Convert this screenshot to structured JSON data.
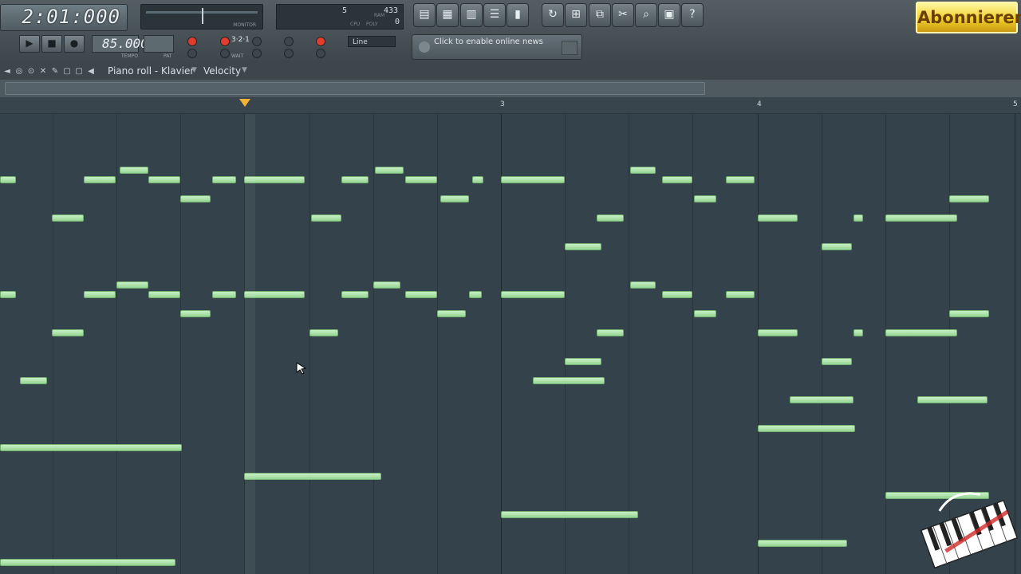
{
  "toolbar": {
    "song_position": "2:01:000",
    "meter_label": "MONITOR",
    "cpu": {
      "value_a": "5",
      "value_b": "433",
      "value_c": "0",
      "label_cpu": "CPU",
      "label_poly": "POLY",
      "label_ram": "RAM"
    },
    "tempo": "85.000",
    "tempo_label": "TEMPO",
    "pattern_label": "PAT",
    "snap_mode": "Line",
    "count_in": "3·2·1",
    "wait_label": "WAIT",
    "news_text": "Click to enable online news",
    "subscribe_label": "Abonnieren"
  },
  "piano_roll": {
    "title": "Piano roll - Klavier",
    "target": "Velocity",
    "bar_labels": [
      "3",
      "4",
      "5"
    ]
  },
  "note_color": "#a8dfa6",
  "icons": [
    "playlist-icon",
    "step-sequencer-icon",
    "piano-roll-icon",
    "browser-icon",
    "mixer-icon",
    "undo-icon",
    "save-icon",
    "plugin-icon",
    "cut-icon",
    "search-icon",
    "project-info-icon",
    "help-icon",
    "draw-cursor-icon"
  ]
}
